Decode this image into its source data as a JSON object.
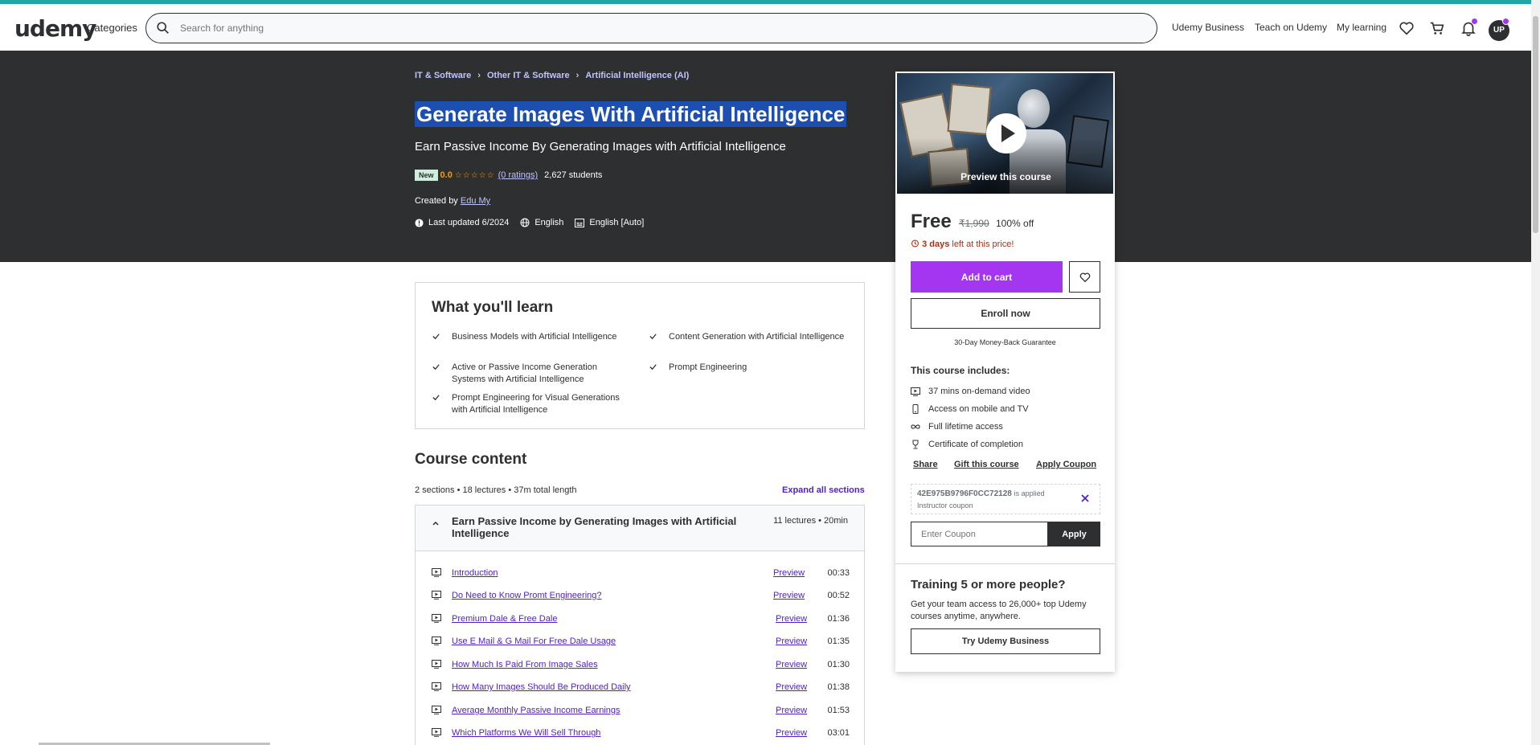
{
  "header": {
    "logo": "udemy",
    "categories": "Categories",
    "search_placeholder": "Search for anything",
    "links": [
      "Udemy Business",
      "Teach on Udemy",
      "My learning"
    ],
    "avatar_initials": "UP",
    "accent_color": "#a435f0"
  },
  "breadcrumb": [
    "IT & Software",
    "Other IT & Software",
    "Artificial Intelligence (AI)"
  ],
  "course": {
    "title": "Generate Images With Artificial Intelligence",
    "subtitle": "Earn Passive Income By Generating Images with Artificial Intelligence",
    "badge": "New",
    "rating": "0.0",
    "ratings_count": "(0 ratings)",
    "students": "2,627 students",
    "created_by_label": "Created by",
    "author": "Edu My",
    "last_updated": "Last updated 6/2024",
    "language": "English",
    "captions": "English [Auto]"
  },
  "learn": {
    "title": "What you'll learn",
    "items": [
      "Business Models with Artificial Intelligence",
      "Content Generation with Artificial Intelligence",
      "Active or Passive Income Generation Systems with Artificial Intelligence",
      "Prompt Engineering",
      "Prompt Engineering for Visual Generations with Artificial Intelligence"
    ]
  },
  "content": {
    "title": "Course content",
    "meta": "2 sections • 18 lectures • 37m total length",
    "expand": "Expand all sections",
    "section": {
      "name": "Earn Passive Income by Generating Images with Artificial Intelligence",
      "info": "11 lectures • 20min"
    },
    "lectures": [
      {
        "name": "Introduction",
        "preview": "Preview",
        "duration": "00:33"
      },
      {
        "name": "Do Need to Know Promt Engineering?",
        "preview": "Preview",
        "duration": "00:52"
      },
      {
        "name": "Premium Dale & Free Dale",
        "preview": "Preview",
        "duration": "01:36"
      },
      {
        "name": "Use E Mail & G Mail For Free Dale Usage",
        "preview": "Preview",
        "duration": "01:35"
      },
      {
        "name": "How Much Is Paid From Image Sales",
        "preview": "Preview",
        "duration": "01:30"
      },
      {
        "name": "How Many Images Should Be Produced Daily",
        "preview": "Preview",
        "duration": "01:38"
      },
      {
        "name": "Average Monthly Passive Income Earnings",
        "preview": "Preview",
        "duration": "01:53"
      },
      {
        "name": "Which Platforms We Will Sell Through",
        "preview": "Preview",
        "duration": "03:01"
      }
    ]
  },
  "sidebar": {
    "preview_label": "Preview this course",
    "price": "Free",
    "original_price": "₹1,990",
    "discount": "100% off",
    "timer_bold": "3 days",
    "timer_rest": "left at this price!",
    "add_to_cart": "Add to cart",
    "enroll": "Enroll now",
    "guarantee": "30-Day Money-Back Guarantee",
    "includes_title": "This course includes:",
    "includes": [
      "37 mins on-demand video",
      "Access on mobile and TV",
      "Full lifetime access",
      "Certificate of completion"
    ],
    "share": "Share",
    "gift": "Gift this course",
    "apply_coupon": "Apply Coupon",
    "coupon_code": "42E975B9796F0CC72128",
    "coupon_applied": "is applied",
    "coupon_type": "Instructor coupon",
    "coupon_placeholder": "Enter Coupon",
    "apply": "Apply",
    "training_title": "Training 5 or more people?",
    "training_desc": "Get your team access to 26,000+ top Udemy courses anytime, anywhere.",
    "try_business": "Try Udemy Business"
  }
}
